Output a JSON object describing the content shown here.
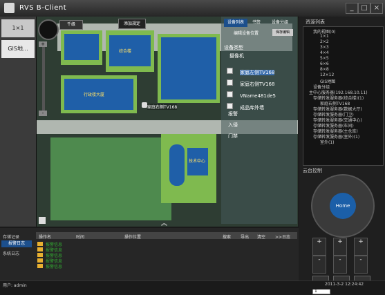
{
  "window": {
    "title": "RVS B-Client",
    "min": "_",
    "max": "□",
    "close": "×"
  },
  "left_tabs": [
    "1×1",
    "GIS地..."
  ],
  "map_toolbar": {
    "zoom_label": "千级",
    "add_label": "添加规定",
    "top_tabs": [
      "设备列表",
      "书签",
      "设备分组"
    ],
    "sub_btns": [
      "编辑设备位置",
      "保存编辑"
    ]
  },
  "map_labels": {
    "building1": "综合楼",
    "building2": "行政楼大厦",
    "building3": "技术中心",
    "camera_label": "家庭右侧TV168"
  },
  "device_panel": {
    "title": "设备类型",
    "group": "摄像机",
    "items": [
      "家庭左侧TV168",
      "家庭右侧TV168",
      "VName481de5",
      "成品库外墙"
    ],
    "extra": [
      "报警",
      "入侵",
      "门禁"
    ]
  },
  "tree": {
    "title": "资源列表",
    "items": [
      "我的视图(0)",
      "1×1",
      "2×2",
      "3×3",
      "4×4",
      "5×5",
      "6×6",
      "8×8",
      "12×12",
      "GIS地图",
      "设备分组",
      "主中心服务器(192.168.10.11)",
      "存储转发服务器(综合楼)(1)",
      "家庭右侧TV168",
      "存储转发服务器(数据大厅)",
      "存储转发服务器(门卫)",
      "存储转发服务器(交通中心)",
      "存储转发服务器(车间)",
      "存储转发服务器(主仓库)",
      "存储转发服务器(室外)(1)",
      "室外(1)"
    ]
  },
  "ptz": {
    "title": "云台控制",
    "center": "Home",
    "buttons": [
      "+",
      "+",
      "+",
      "-",
      "-",
      "-"
    ],
    "preset": "1"
  },
  "bottom": {
    "tabs": [
      "存储记录",
      "报警日志",
      "系统日志"
    ],
    "columns": [
      "操作名",
      "时间",
      "操作位置"
    ],
    "actions": [
      "搜索",
      "导出",
      "清空",
      ">>日志"
    ],
    "rows": [
      "报警信息",
      "报警信息",
      "报警信息",
      "报警信息",
      "报警信息"
    ]
  },
  "status": {
    "user": "用户: admin",
    "time": "2011-3-2 12:24:42"
  }
}
